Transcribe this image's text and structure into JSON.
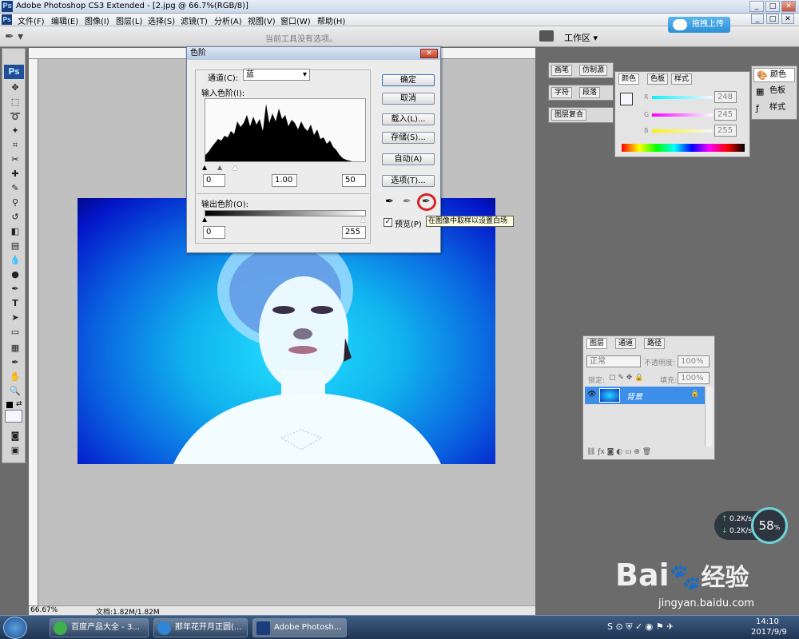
{
  "window": {
    "title": "Adobe Photoshop CS3 Extended - [2.jpg @ 66.7%(RGB/8)]",
    "app_icon": "Ps"
  },
  "menu": [
    "文件(F)",
    "编辑(E)",
    "图像(I)",
    "图层(L)",
    "选择(S)",
    "滤镜(T)",
    "分析(A)",
    "视图(V)",
    "窗口(W)",
    "帮助(H)"
  ],
  "options_bar": {
    "hint": "当前工具没有选项。",
    "workspace": "工作区 ▾",
    "upload_button": "拖拽上传"
  },
  "toolbox": {
    "logo": "Ps"
  },
  "status": {
    "zoom": "66.67%",
    "doc": "文档:1.82M/1.82M"
  },
  "levels_dialog": {
    "title": "色阶",
    "channel_label": "通道(C):",
    "channel_value": "蓝",
    "input_label": "输入色阶(I):",
    "input_values": [
      "0",
      "1.00",
      "50"
    ],
    "output_label": "输出色阶(O):",
    "output_values": [
      "0",
      "255"
    ],
    "buttons": [
      "确定",
      "取消",
      "载入(L)...",
      "存储(S)...",
      "自动(A)",
      "选项(T)..."
    ],
    "preview_label": "预览(P)",
    "tooltip": "在图像中取样以设置白场"
  },
  "panels": {
    "brush_tabs": [
      "画笔",
      "仿制源"
    ],
    "char_tabs": [
      "字符",
      "段落"
    ],
    "comp_tabs": [
      "图层复合"
    ],
    "color_tabs": [
      "颜色",
      "色板",
      "样式"
    ],
    "color_rgb": [
      {
        "ch": "R",
        "val": "248"
      },
      {
        "ch": "G",
        "val": "245"
      },
      {
        "ch": "B",
        "val": "255"
      }
    ],
    "side_buttons": [
      "颜色",
      "色板",
      "样式"
    ],
    "layers_tabs": [
      "图层",
      "通道",
      "路径"
    ],
    "layers_mode": "正常",
    "opacity_label": "不透明度:",
    "opacity_value": "100%",
    "lock_label": "锁定:",
    "fill_label": "填充:",
    "fill_value": "100%",
    "layer_name": "背景"
  },
  "net_widget": {
    "up": "0.2K/s",
    "down": "0.2K/s",
    "percent": "58",
    "pct_sign": "%"
  },
  "watermark": {
    "brand": "Bai",
    "brand2": "经验",
    "url": "jingyan.baidu.com"
  },
  "taskbar": {
    "tasks": [
      "百度产品大全 - 3...",
      "那年花开月正圆(...",
      "Adobe Photosh..."
    ],
    "time": "14:10",
    "date": "2017/9/9"
  }
}
